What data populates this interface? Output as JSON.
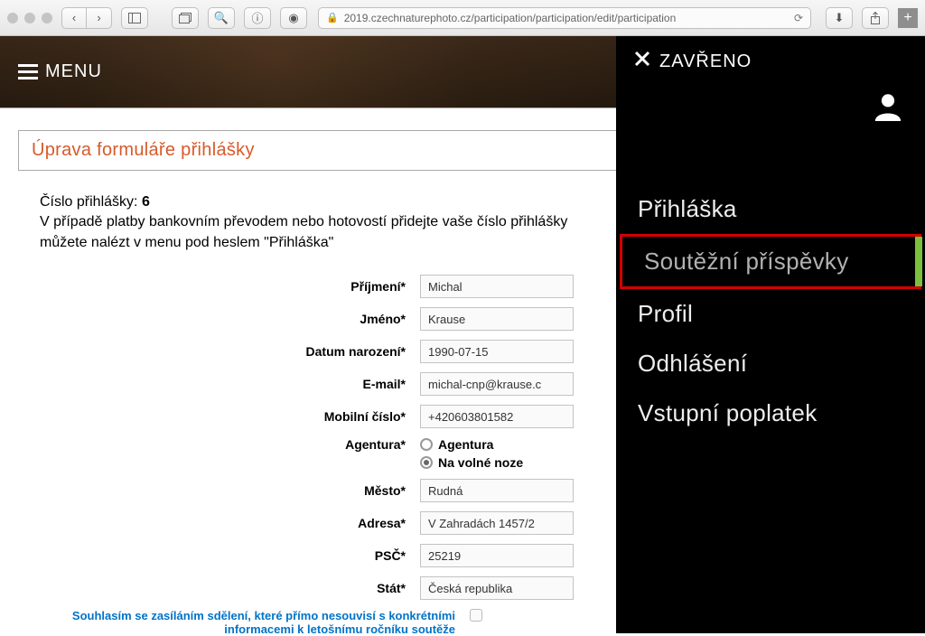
{
  "browser": {
    "url_display": "2019.czechnaturephoto.cz/participation/participation/edit/participation"
  },
  "header": {
    "menu_label": "MENU"
  },
  "page": {
    "title": "Úprava formuláře přihlášky",
    "app_number_label": "Číslo přihlášky:",
    "app_number": "6",
    "intro_line1": "V případě platby bankovním převodem nebo hotovostí přidejte vaše číslo přihlášky",
    "intro_line2": "můžete nalézt v menu pod heslem \"Přihláška\""
  },
  "form": {
    "prijmeni": {
      "label": "Příjmení*",
      "value": "Michal"
    },
    "jmeno": {
      "label": "Jméno*",
      "value": "Krause"
    },
    "datum": {
      "label": "Datum narození*",
      "value": "1990-07-15"
    },
    "email": {
      "label": "E-mail*",
      "value": "michal-cnp@krause.c"
    },
    "mobil": {
      "label": "Mobilní číslo*",
      "value": "+420603801582"
    },
    "agentura": {
      "label": "Agentura*",
      "opt1": "Agentura",
      "opt2": "Na volné noze",
      "selected": "opt2"
    },
    "mesto": {
      "label": "Město*",
      "value": "Rudná"
    },
    "adresa": {
      "label": "Adresa*",
      "value": "V Zahradách 1457/2"
    },
    "psc": {
      "label": "PSČ*",
      "value": "25219"
    },
    "stat": {
      "label": "Stát*",
      "value": "Česká republika"
    },
    "consent_label": "Souhlasím se zasíláním sdělení, které přímo nesouvisí s konkrétními informacemi k letošnímu ročníku soutěže"
  },
  "side_panel": {
    "close_label": "ZAVŘENO",
    "items": [
      {
        "label": "Přihláška"
      },
      {
        "label": "Soutěžní příspěvky"
      },
      {
        "label": "Profil"
      },
      {
        "label": "Odhlášení"
      },
      {
        "label": "Vstupní poplatek"
      }
    ],
    "highlighted_index": 1
  }
}
